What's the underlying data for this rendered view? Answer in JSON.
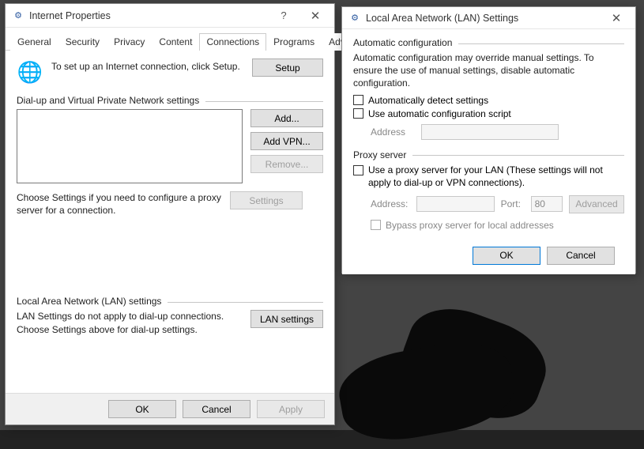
{
  "dialog1": {
    "title": "Internet Properties",
    "help": "?",
    "close": "✕",
    "tabs": [
      "General",
      "Security",
      "Privacy",
      "Content",
      "Connections",
      "Programs",
      "Advanced"
    ],
    "active_tab": 4,
    "setup_text": "To set up an Internet connection, click Setup.",
    "setup_btn": "Setup",
    "dial_group": "Dial-up and Virtual Private Network settings",
    "add_btn": "Add...",
    "addvpn_btn": "Add VPN...",
    "remove_btn": "Remove...",
    "settings_btn": "Settings",
    "choose_text": "Choose Settings if you need to configure a proxy server for a connection.",
    "lan_group": "Local Area Network (LAN) settings",
    "lan_text": "LAN Settings do not apply to dial-up connections. Choose Settings above for dial-up settings.",
    "lan_btn": "LAN settings",
    "ok": "OK",
    "cancel": "Cancel",
    "apply": "Apply"
  },
  "dialog2": {
    "title": "Local Area Network (LAN) Settings",
    "close": "✕",
    "auto_group": "Automatic configuration",
    "auto_text": "Automatic configuration may override manual settings.  To ensure the use of manual settings, disable automatic configuration.",
    "chk_auto": "Automatically detect settings",
    "chk_script": "Use automatic configuration script",
    "addr_label": "Address",
    "proxy_group": "Proxy server",
    "chk_proxy": "Use a proxy server for your LAN (These settings will not apply to dial-up or VPN connections).",
    "addr2_label": "Address:",
    "port_label": "Port:",
    "port_value": "80",
    "advanced_btn": "Advanced",
    "chk_bypass": "Bypass proxy server for local addresses",
    "ok": "OK",
    "cancel": "Cancel"
  }
}
